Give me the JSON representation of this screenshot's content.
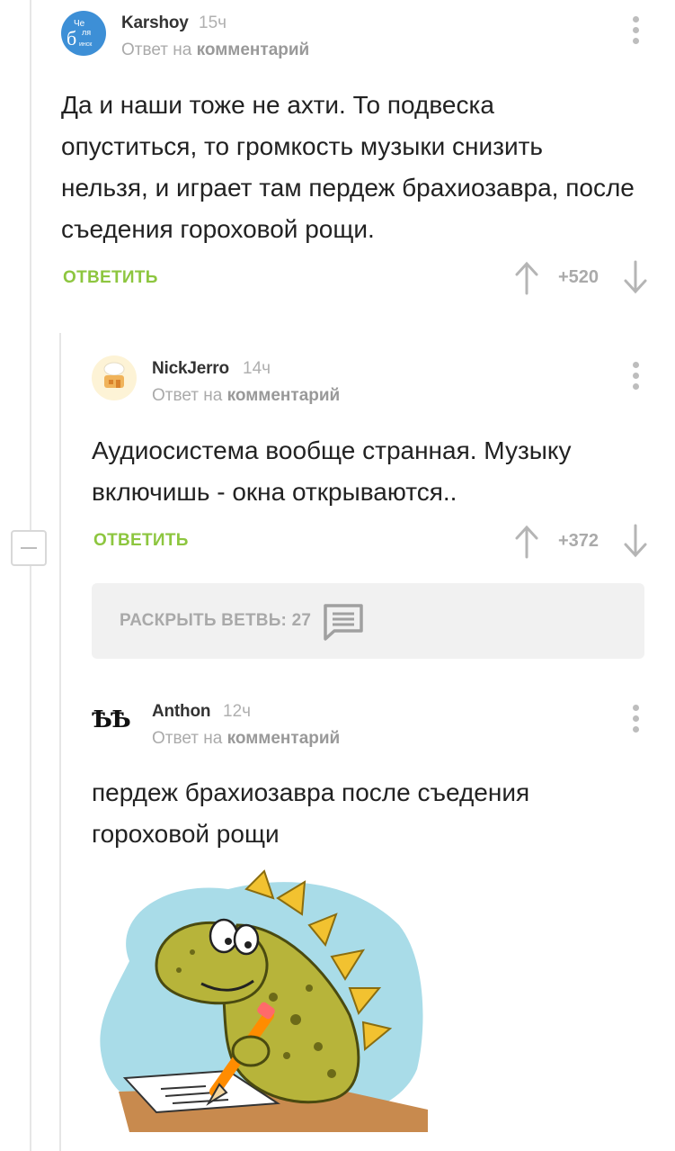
{
  "comments": [
    {
      "author": "Karshoy",
      "time": "15ч",
      "reply_prefix": "Ответ на",
      "reply_target": "комментарий",
      "avatar_text": [
        "Че",
        "ля",
        "б",
        "инск"
      ],
      "text": "Да и наши тоже не ахти. То подвеска опуститься, то громкость музыки снизить нельзя, и играет там пердеж брахиозавра, после съедения гороховой рощи.",
      "reply_label": "ОТВЕТИТЬ",
      "rating": "+520"
    },
    {
      "author": "NickJerro",
      "time": "14ч",
      "reply_prefix": "Ответ на",
      "reply_target": "комментарий",
      "text": "Аудиосистема вообще странная. Музыку включишь - окна открываются..",
      "reply_label": "ОТВЕТИТЬ",
      "rating": "+372"
    },
    {
      "author": "Anthon",
      "time": "12ч",
      "reply_prefix": "Ответ на",
      "reply_target": "комментарий",
      "avatar_text": "ѢѢ",
      "text": "пердеж брахиозавра после съедения гороховой рощи"
    }
  ],
  "expand_branch": {
    "label": "РАСКРЫТЬ ВЕТВЬ: 27"
  },
  "colors": {
    "accent_green": "#8dc63f",
    "muted": "#aaaaaa",
    "avatar_blue": "#3d8fd6",
    "panel": "#f1f1f1"
  },
  "icons": {
    "kebab": "more-vertical-icon",
    "upvote": "arrow-up-icon",
    "downvote": "arrow-down-icon",
    "expand": "comments-icon",
    "collapse": "minus-icon"
  }
}
